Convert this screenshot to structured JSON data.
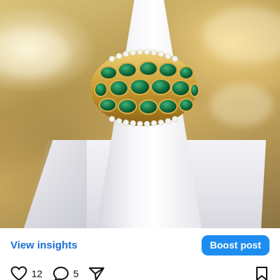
{
  "post": {
    "image_alt": "Gold ring with rows of oval emeralds and diamond borders on a white ring cone",
    "accent_color": "#1d8df0"
  },
  "actions": {
    "view_insights_label": "View insights",
    "boost_post_label": "Boost post"
  },
  "engagement": {
    "like_count": "12",
    "comment_count": "5"
  },
  "icons": {
    "like": "heart-icon",
    "comment": "comment-bubble-icon",
    "share": "paper-plane-icon",
    "save": "bookmark-icon"
  }
}
